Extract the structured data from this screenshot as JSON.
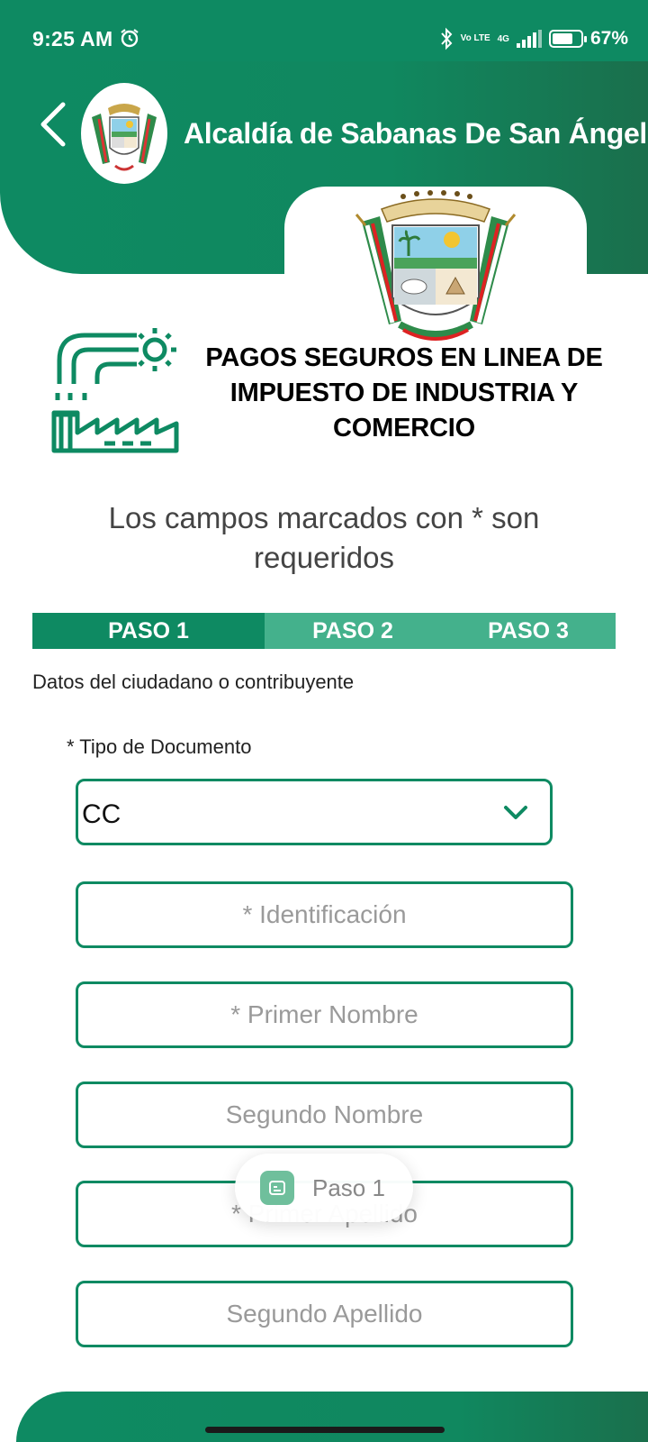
{
  "status_bar": {
    "time": "9:25 AM",
    "network_volte": "Vo LTE",
    "network_type": "4G",
    "battery": "67%"
  },
  "header": {
    "title": "Alcaldía de Sabanas De San Ángel"
  },
  "page": {
    "title": "PAGOS SEGUROS EN LINEA DE IMPUESTO DE INDUSTRIA Y COMERCIO",
    "required_note": "Los campos marcados con  * son requeridos"
  },
  "steps": [
    {
      "label": "PASO 1",
      "active": true
    },
    {
      "label": "PASO 2",
      "active": false
    },
    {
      "label": "PASO 3",
      "active": false
    }
  ],
  "form": {
    "section_label": "Datos del ciudadano o contribuyente",
    "doc_type_label": "* Tipo de Documento",
    "doc_type_value": "CC",
    "identificacion_placeholder": "* Identificación",
    "primer_nombre_placeholder": "* Primer Nombre",
    "segundo_nombre_placeholder": "Segundo Nombre",
    "primer_apellido_placeholder": "* Primer Apellido",
    "segundo_apellido_placeholder": "Segundo Apellido"
  },
  "toast": {
    "text": "Paso 1"
  },
  "colors": {
    "primary": "#0e8a62",
    "primary_light": "#44b18c",
    "dark_green": "#1a6f4c"
  },
  "icons": [
    "alarm-icon",
    "bluetooth-icon",
    "signal-icon",
    "battery-icon",
    "back-arrow-icon",
    "factory-icon",
    "chevron-down-icon",
    "app-icon"
  ]
}
